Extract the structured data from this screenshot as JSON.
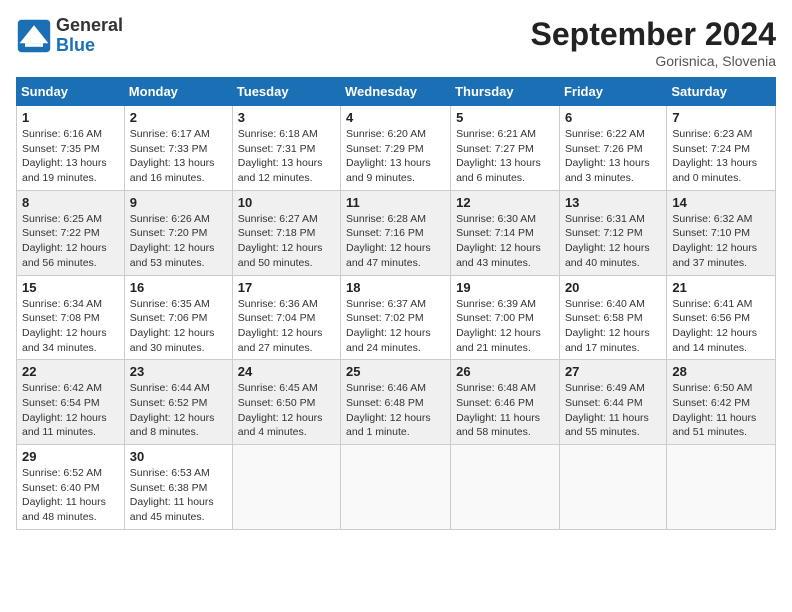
{
  "header": {
    "title": "September 2024",
    "location": "Gorisnica, Slovenia",
    "logo_line1": "General",
    "logo_line2": "Blue"
  },
  "days_of_week": [
    "Sunday",
    "Monday",
    "Tuesday",
    "Wednesday",
    "Thursday",
    "Friday",
    "Saturday"
  ],
  "weeks": [
    [
      {
        "day": 1,
        "info": "Sunrise: 6:16 AM\nSunset: 7:35 PM\nDaylight: 13 hours\nand 19 minutes."
      },
      {
        "day": 2,
        "info": "Sunrise: 6:17 AM\nSunset: 7:33 PM\nDaylight: 13 hours\nand 16 minutes."
      },
      {
        "day": 3,
        "info": "Sunrise: 6:18 AM\nSunset: 7:31 PM\nDaylight: 13 hours\nand 12 minutes."
      },
      {
        "day": 4,
        "info": "Sunrise: 6:20 AM\nSunset: 7:29 PM\nDaylight: 13 hours\nand 9 minutes."
      },
      {
        "day": 5,
        "info": "Sunrise: 6:21 AM\nSunset: 7:27 PM\nDaylight: 13 hours\nand 6 minutes."
      },
      {
        "day": 6,
        "info": "Sunrise: 6:22 AM\nSunset: 7:26 PM\nDaylight: 13 hours\nand 3 minutes."
      },
      {
        "day": 7,
        "info": "Sunrise: 6:23 AM\nSunset: 7:24 PM\nDaylight: 13 hours\nand 0 minutes."
      }
    ],
    [
      {
        "day": 8,
        "info": "Sunrise: 6:25 AM\nSunset: 7:22 PM\nDaylight: 12 hours\nand 56 minutes."
      },
      {
        "day": 9,
        "info": "Sunrise: 6:26 AM\nSunset: 7:20 PM\nDaylight: 12 hours\nand 53 minutes."
      },
      {
        "day": 10,
        "info": "Sunrise: 6:27 AM\nSunset: 7:18 PM\nDaylight: 12 hours\nand 50 minutes."
      },
      {
        "day": 11,
        "info": "Sunrise: 6:28 AM\nSunset: 7:16 PM\nDaylight: 12 hours\nand 47 minutes."
      },
      {
        "day": 12,
        "info": "Sunrise: 6:30 AM\nSunset: 7:14 PM\nDaylight: 12 hours\nand 43 minutes."
      },
      {
        "day": 13,
        "info": "Sunrise: 6:31 AM\nSunset: 7:12 PM\nDaylight: 12 hours\nand 40 minutes."
      },
      {
        "day": 14,
        "info": "Sunrise: 6:32 AM\nSunset: 7:10 PM\nDaylight: 12 hours\nand 37 minutes."
      }
    ],
    [
      {
        "day": 15,
        "info": "Sunrise: 6:34 AM\nSunset: 7:08 PM\nDaylight: 12 hours\nand 34 minutes."
      },
      {
        "day": 16,
        "info": "Sunrise: 6:35 AM\nSunset: 7:06 PM\nDaylight: 12 hours\nand 30 minutes."
      },
      {
        "day": 17,
        "info": "Sunrise: 6:36 AM\nSunset: 7:04 PM\nDaylight: 12 hours\nand 27 minutes."
      },
      {
        "day": 18,
        "info": "Sunrise: 6:37 AM\nSunset: 7:02 PM\nDaylight: 12 hours\nand 24 minutes."
      },
      {
        "day": 19,
        "info": "Sunrise: 6:39 AM\nSunset: 7:00 PM\nDaylight: 12 hours\nand 21 minutes."
      },
      {
        "day": 20,
        "info": "Sunrise: 6:40 AM\nSunset: 6:58 PM\nDaylight: 12 hours\nand 17 minutes."
      },
      {
        "day": 21,
        "info": "Sunrise: 6:41 AM\nSunset: 6:56 PM\nDaylight: 12 hours\nand 14 minutes."
      }
    ],
    [
      {
        "day": 22,
        "info": "Sunrise: 6:42 AM\nSunset: 6:54 PM\nDaylight: 12 hours\nand 11 minutes."
      },
      {
        "day": 23,
        "info": "Sunrise: 6:44 AM\nSunset: 6:52 PM\nDaylight: 12 hours\nand 8 minutes."
      },
      {
        "day": 24,
        "info": "Sunrise: 6:45 AM\nSunset: 6:50 PM\nDaylight: 12 hours\nand 4 minutes."
      },
      {
        "day": 25,
        "info": "Sunrise: 6:46 AM\nSunset: 6:48 PM\nDaylight: 12 hours\nand 1 minute."
      },
      {
        "day": 26,
        "info": "Sunrise: 6:48 AM\nSunset: 6:46 PM\nDaylight: 11 hours\nand 58 minutes."
      },
      {
        "day": 27,
        "info": "Sunrise: 6:49 AM\nSunset: 6:44 PM\nDaylight: 11 hours\nand 55 minutes."
      },
      {
        "day": 28,
        "info": "Sunrise: 6:50 AM\nSunset: 6:42 PM\nDaylight: 11 hours\nand 51 minutes."
      }
    ],
    [
      {
        "day": 29,
        "info": "Sunrise: 6:52 AM\nSunset: 6:40 PM\nDaylight: 11 hours\nand 48 minutes."
      },
      {
        "day": 30,
        "info": "Sunrise: 6:53 AM\nSunset: 6:38 PM\nDaylight: 11 hours\nand 45 minutes."
      },
      null,
      null,
      null,
      null,
      null
    ]
  ]
}
